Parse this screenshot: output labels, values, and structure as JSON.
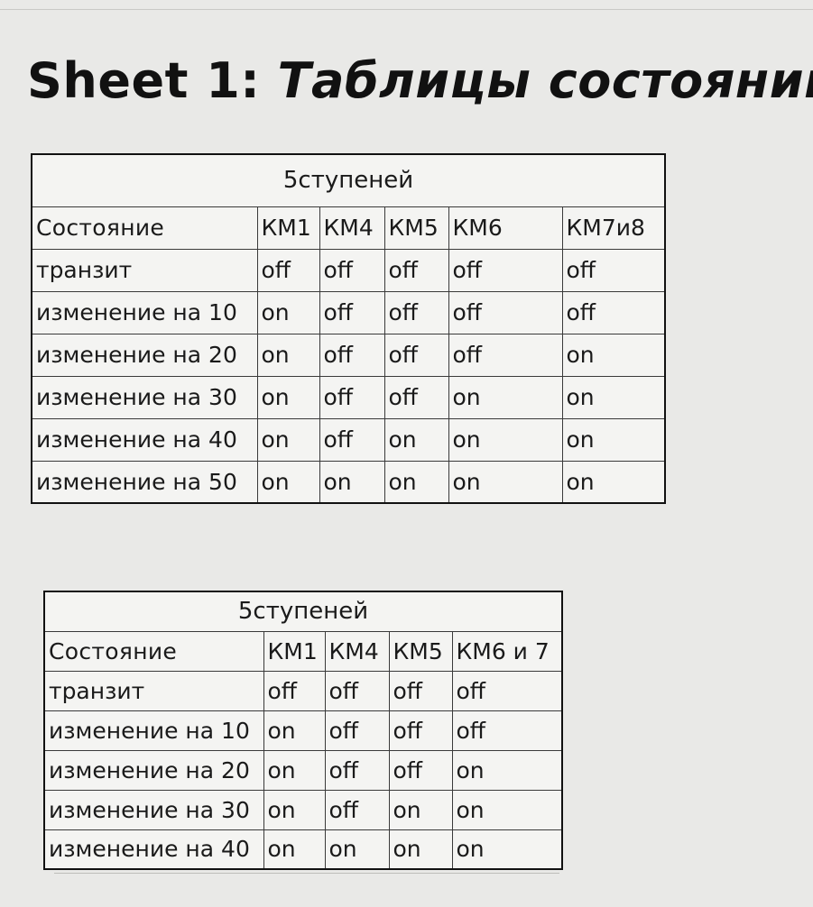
{
  "sheet": {
    "prefix": "Sheet 1: ",
    "title": "Таблицы состояний"
  },
  "table1": {
    "caption": "5ступеней",
    "headers": [
      "Состояние",
      "КМ1",
      "КМ4",
      "КМ5",
      "КМ6",
      "КМ7и8"
    ],
    "rows": [
      [
        "транзит",
        "off",
        "off",
        "off",
        "off",
        "off"
      ],
      [
        "изменение на 10",
        "on",
        "off",
        "off",
        "off",
        "off"
      ],
      [
        "изменение на 20",
        "on",
        "off",
        "off",
        "off",
        "on"
      ],
      [
        "изменение на 30",
        "on",
        "off",
        "off",
        "on",
        "on"
      ],
      [
        "изменение на 40",
        "on",
        "off",
        "on",
        "on",
        "on"
      ],
      [
        "изменение на 50",
        "on",
        "on",
        "on",
        "on",
        "on"
      ]
    ]
  },
  "table2": {
    "caption": "5ступеней",
    "headers": [
      "Состояние",
      "КМ1",
      "КМ4",
      "КМ5",
      "КМ6 и 7"
    ],
    "rows": [
      [
        "транзит",
        "off",
        "off",
        "off",
        "off"
      ],
      [
        "изменение на 10",
        "on",
        "off",
        "off",
        "off"
      ],
      [
        "изменение на 20",
        "on",
        "off",
        "off",
        "on"
      ],
      [
        "изменение на 30",
        "on",
        "off",
        "on",
        "on"
      ],
      [
        "изменение на 40",
        "on",
        "on",
        "on",
        "on"
      ]
    ]
  }
}
